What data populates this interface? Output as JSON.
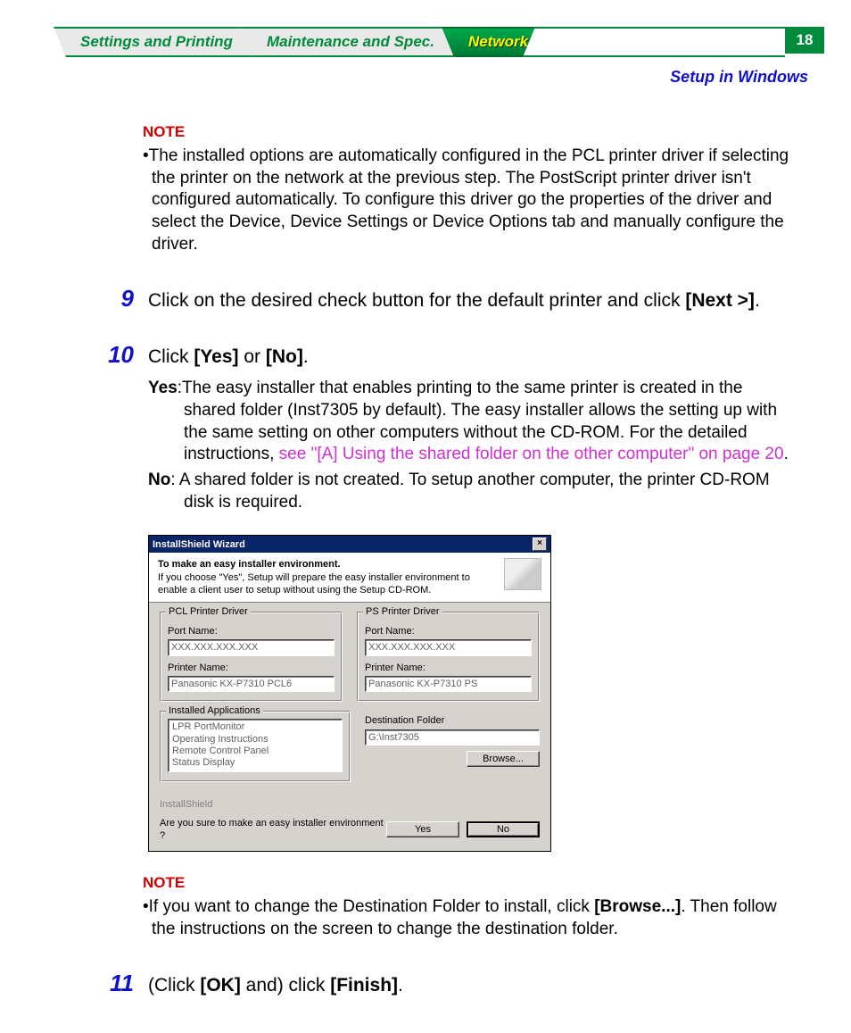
{
  "tabs": {
    "settings": "Settings and Printing",
    "maintenance": "Maintenance and Spec.",
    "network": "Network"
  },
  "page_number": "18",
  "subhead": "Setup in Windows",
  "note1": {
    "label": "NOTE",
    "bullet": "•",
    "text": "The installed options are automatically configured in the PCL printer driver if selecting the printer on the network at the previous step.  The PostScript printer driver isn't configured automatically.  To configure this driver go the properties of the driver and select the Device, Device Settings or Device Options tab and manually configure the driver."
  },
  "step9": {
    "num": "9",
    "text_a": "Click on the desired check button for the default printer and click ",
    "bold": "[Next >]",
    "text_b": "."
  },
  "step10": {
    "num": "10",
    "text_a": "Click ",
    "bold1": "[Yes]",
    "text_mid": " or ",
    "bold2": "[No]",
    "text_b": ".",
    "yes_label": "Yes",
    "yes_text": ":The easy installer that enables printing to the same printer is created in the shared folder (Inst7305 by default). The easy installer allows the setting up with the same setting on other computers without the CD-ROM.  For the detailed instructions, ",
    "yes_link": "see \"[A] Using the shared folder on the other computer\" on page 20",
    "yes_tail": ".",
    "no_label": "No",
    "no_text": ": A shared folder is not created. To setup another computer, the printer CD-ROM disk is required."
  },
  "dialog": {
    "title": "InstallShield Wizard",
    "header_bold": "To make an easy installer environment.",
    "header_text": "If you choose \"Yes\", Setup will prepare the easy installer environment to enable a client user to setup without using the Setup CD-ROM.",
    "pcl_group": "PCL Printer Driver",
    "ps_group": "PS Printer Driver",
    "port_label": "Port Name:",
    "port_value": "XXX.XXX.XXX.XXX",
    "printer_label": "Printer Name:",
    "pcl_printer": "Panasonic KX-P7310 PCL6",
    "ps_printer": "Panasonic KX-P7310 PS",
    "apps_group": "Installed Applications",
    "apps": [
      "LPR PortMonitor",
      "Operating Instructions",
      "Remote Control Panel",
      "Status Display"
    ],
    "dest_label": "Destination Folder",
    "dest_value": "G:\\Inst7305",
    "browse_btn": "Browse...",
    "shield_label": "InstallShield",
    "question": "Are you sure to make an easy installer environment ?",
    "yes_btn": "Yes",
    "no_btn": "No"
  },
  "note2": {
    "label": "NOTE",
    "bullet": "•",
    "text_a": "If you want to change the Destination Folder to install, click ",
    "bold": "[Browse...]",
    "text_b": ". Then follow the ",
    "text_c": "instructions on the screen to change the destination folder."
  },
  "step11": {
    "num": "11",
    "text_a": "(Click ",
    "bold1": "[OK]",
    "text_mid": " and) click ",
    "bold2": "[Finish]",
    "text_b": "."
  }
}
